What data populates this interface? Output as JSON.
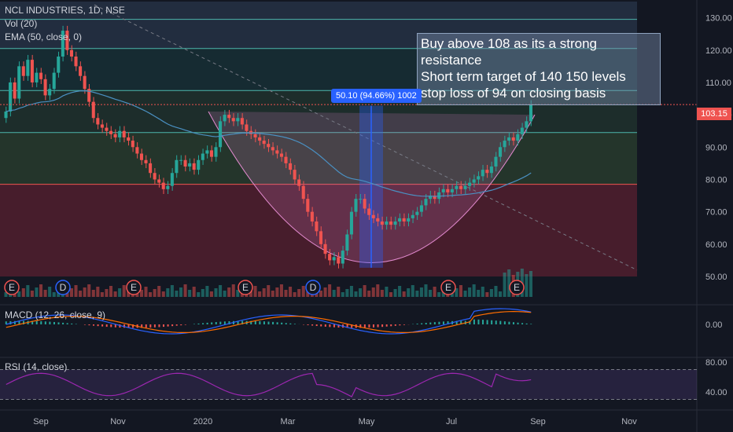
{
  "header": {
    "symbol": "NCL INDUSTRIES, 1D, NSE",
    "vol": "Vol (20)",
    "ema": "EMA (50, close, 0)"
  },
  "macd_label": "MACD (12, 26, close, 9)",
  "rsi_label": "RSI (14, close)",
  "annotation": {
    "lines": [
      "Buy above 108 as its a strong resistance",
      "Short term target of 140 150 levels",
      "stop loss of 94 on closing basis"
    ]
  },
  "measure_label": "50.10 (94.66%) 1002",
  "last_price": "103.15",
  "colors": {
    "up": "#26a69a",
    "down": "#ef5350",
    "ema": "#4a90c2",
    "macd": "#2962ff",
    "signal": "#ff6d00",
    "rsi": "#9c27b0"
  },
  "chart_data": {
    "type": "candlestick",
    "price_axis": {
      "ticks": [
        "130.00",
        "120.00",
        "110.00",
        "100.00",
        "90.00",
        "80.00",
        "70.00",
        "60.00",
        "50.00"
      ],
      "ylim": [
        50,
        135
      ]
    },
    "macd_axis": {
      "ticks": [
        "0.00"
      ]
    },
    "rsi_axis": {
      "ticks": [
        "80.00",
        "40.00"
      ],
      "bands": [
        30,
        70
      ]
    },
    "x_ticks": [
      "Sep",
      "Nov",
      "2020",
      "Mar",
      "May",
      "Jul",
      "Sep",
      "Nov"
    ],
    "horizontal_levels": [
      129.5,
      120.5,
      107.5,
      94.5,
      78.5
    ],
    "events": [
      "E",
      "D",
      "E",
      "E",
      "D",
      "E",
      "E"
    ],
    "close_series": [
      101,
      110,
      105,
      115,
      112,
      117,
      110,
      113,
      111,
      106,
      108,
      113,
      118,
      126,
      120,
      118,
      115,
      112,
      108,
      104,
      99,
      97,
      96,
      95,
      94,
      93,
      95,
      93,
      92,
      90,
      88,
      86,
      85,
      82,
      80,
      79,
      77,
      78,
      82,
      86,
      86,
      84,
      85,
      83,
      86,
      88,
      89,
      87,
      90,
      98,
      100,
      99,
      98,
      99,
      97,
      95,
      94,
      93,
      92,
      91,
      90,
      89,
      88,
      87,
      85,
      83,
      80,
      78,
      74,
      70,
      67,
      64,
      60,
      57,
      55,
      56,
      54,
      58,
      63,
      70,
      74,
      74,
      71,
      69,
      68,
      67,
      66,
      67,
      66,
      67,
      68,
      67,
      68,
      69,
      70,
      72,
      74,
      75,
      74,
      76,
      77,
      76,
      77,
      78,
      77,
      78,
      79,
      80,
      81,
      83,
      82,
      84,
      87,
      90,
      92,
      93,
      92,
      94,
      96,
      98,
      103
    ]
  }
}
